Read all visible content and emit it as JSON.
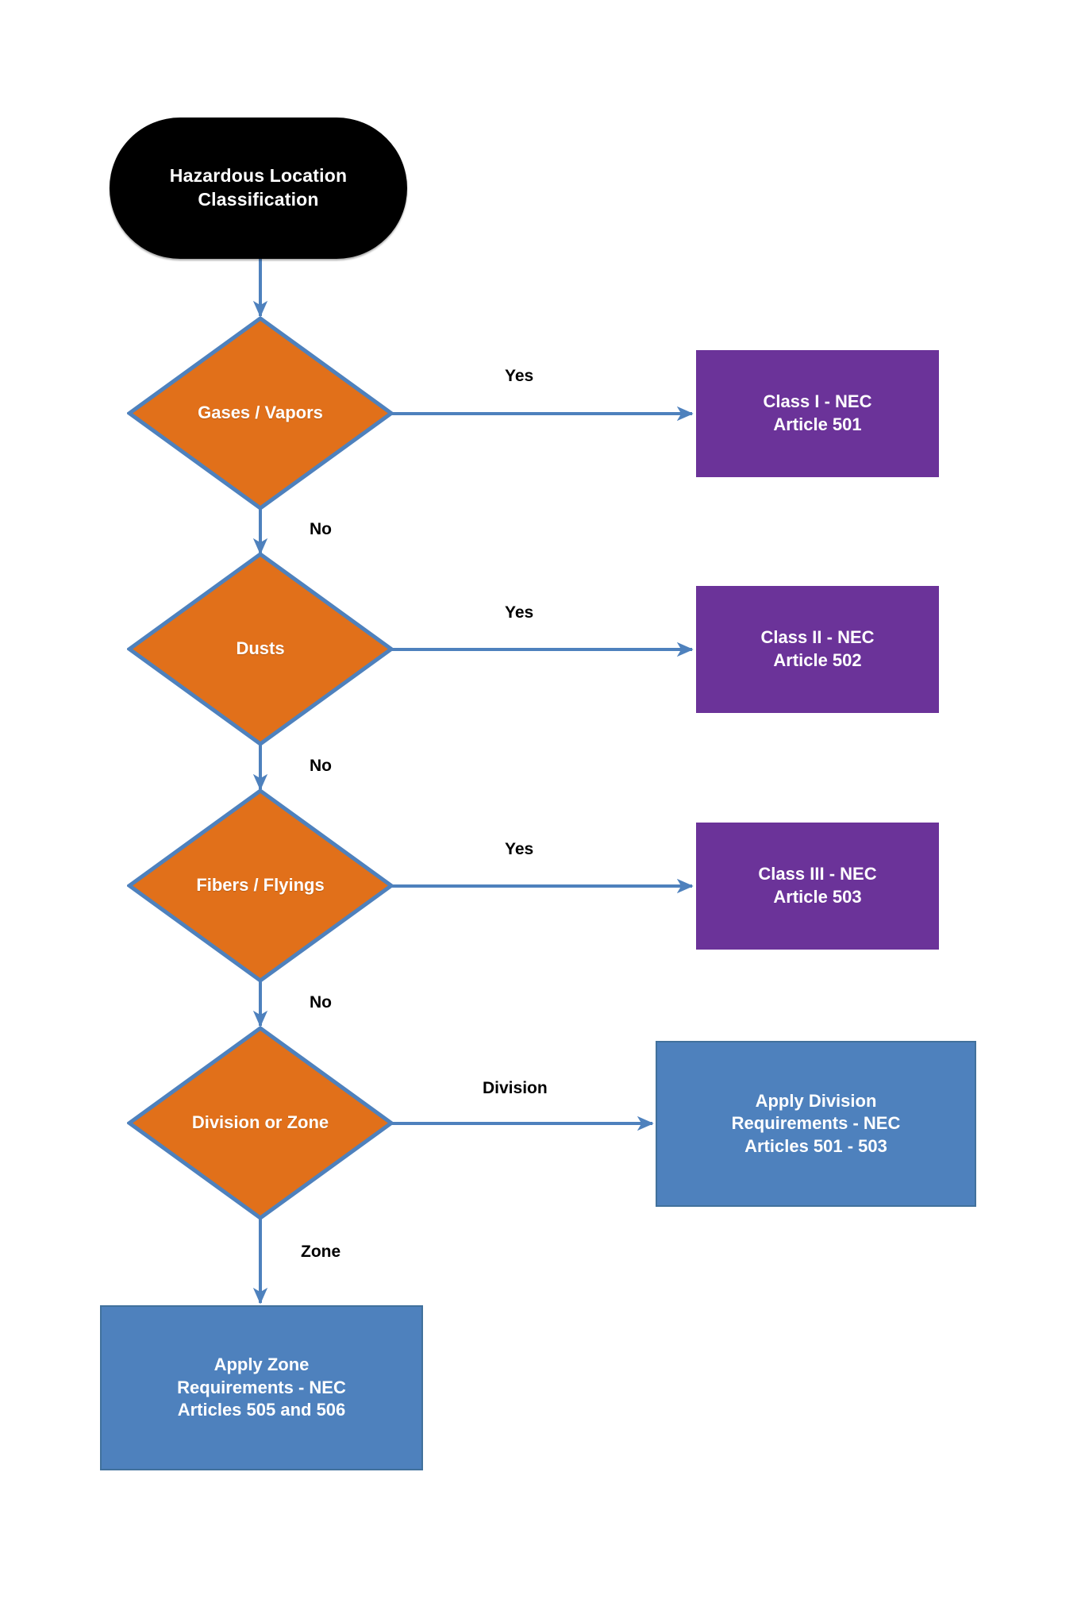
{
  "diagram": {
    "title": "Hazardous Location Classification Decision Flowchart",
    "type": "flowchart",
    "background": "#ffffff",
    "colors": {
      "start_fill": "#000000",
      "decision_fill": "#E1701A",
      "decision_border": "#4E81BD",
      "class_box_fill": "#6B3399",
      "apply_box_fill": "#4E81BD",
      "apply_box_border": "#41719C",
      "connector": "#4E81BD",
      "label_text": "#000000",
      "node_text": "#ffffff"
    }
  },
  "nodes": {
    "start": {
      "label": "Hazardous Location\nClassification",
      "shape": "terminator"
    },
    "decision_gases": {
      "label": "Gases / Vapors",
      "shape": "diamond"
    },
    "decision_dusts": {
      "label": "Dusts",
      "shape": "diamond"
    },
    "decision_fibers": {
      "label": "Fibers / Flyings",
      "shape": "diamond"
    },
    "decision_division_zone": {
      "label": "Division or Zone",
      "shape": "diamond"
    },
    "class_one": {
      "label": "Class I - NEC\nArticle 501",
      "shape": "rectangle"
    },
    "class_two": {
      "label": "Class II - NEC\nArticle 502",
      "shape": "rectangle"
    },
    "class_three": {
      "label": "Class III - NEC\nArticle 503",
      "shape": "rectangle"
    },
    "apply_division": {
      "label": "Apply Division\nRequirements - NEC\nArticles 501 - 503",
      "shape": "rectangle"
    },
    "apply_zone": {
      "label": "Apply Zone\nRequirements - NEC\nArticles 505 and 506",
      "shape": "rectangle"
    }
  },
  "edge_labels": {
    "gases_yes": "Yes",
    "gases_no": "No",
    "dusts_yes": "Yes",
    "dusts_no": "No",
    "fibers_yes": "Yes",
    "fibers_no": "No",
    "division": "Division",
    "zone": "Zone"
  }
}
